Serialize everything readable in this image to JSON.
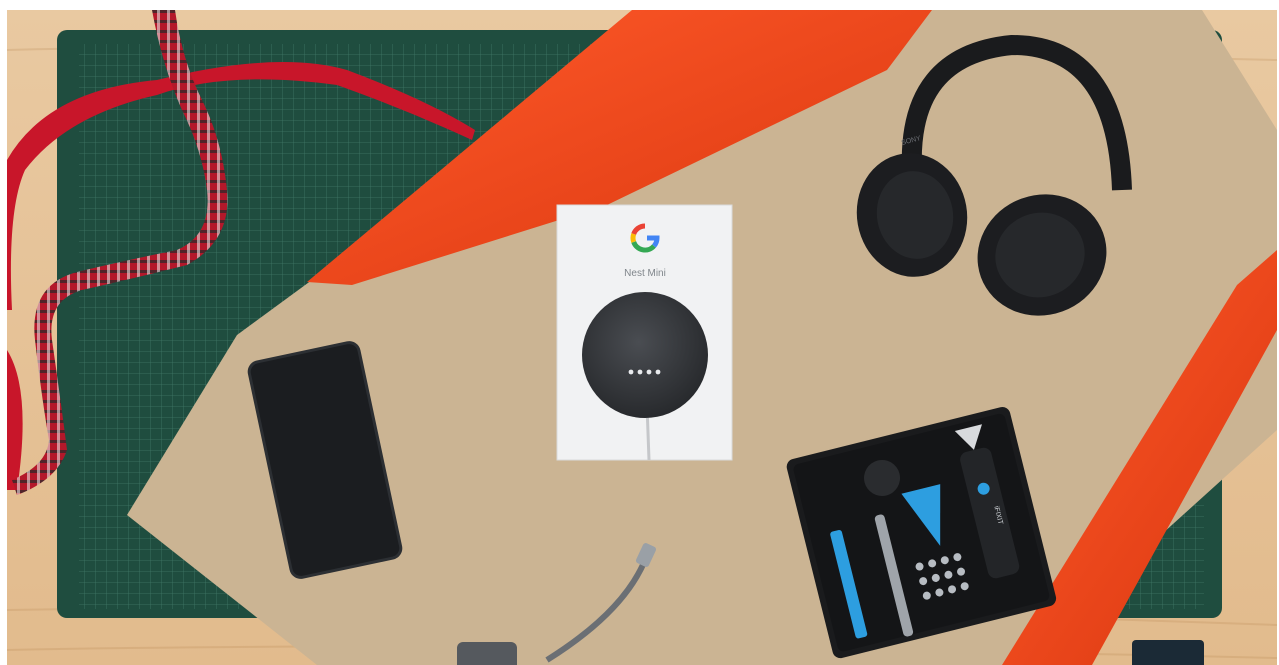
{
  "scene": {
    "background": "#e3bd90",
    "mat_color": "#1f4d3f",
    "paper_color": "#cbb493",
    "wrap_color": "#e8421c",
    "ribbon_color": "#c8162a"
  },
  "nest_box": {
    "brand_letter": "G",
    "product_name": "Nest Mini"
  },
  "headphones": {
    "brand": "SONY"
  },
  "toolkit": {
    "brand": "iFIXIT"
  }
}
